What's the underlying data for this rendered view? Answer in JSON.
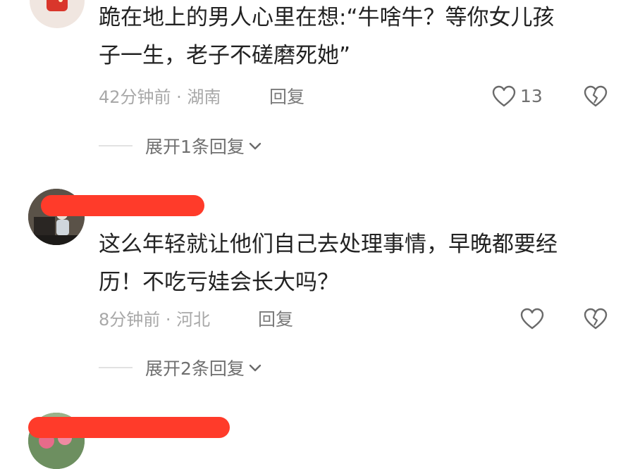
{
  "comments": [
    {
      "text_line1": "跪在地上的男人心里在想:“牛啥牛？等你女儿孩",
      "text_line2": "子一生，老子不磋磨死她”",
      "meta": "42分钟前 · 湖南",
      "reply_label": "回复",
      "like_count": "13",
      "expand_label": "展开1条回复"
    },
    {
      "text_line1": "这么年轻就让他们自己去处理事情，早晚都要经",
      "text_line2": "历！不吃亏娃会长大吗？",
      "meta": "8分钟前 · 河北",
      "reply_label": "回复",
      "like_count": "",
      "expand_label": "展开2条回复"
    }
  ],
  "icons": {
    "like": "heart-outline-icon",
    "dislike": "broken-heart-icon",
    "expand": "chevron-down-icon"
  },
  "colors": {
    "redaction": "#ff3b2a",
    "text": "#222222",
    "meta": "#a8a8a8"
  }
}
